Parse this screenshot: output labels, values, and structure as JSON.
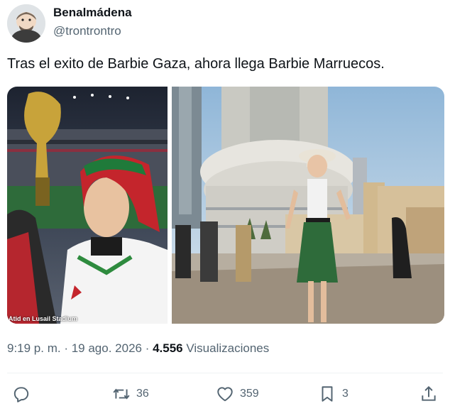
{
  "author": {
    "display_name": "Benalmádena",
    "handle": "@trontrontro",
    "avatar_icon": "cartoon-face-avatar"
  },
  "tweet": {
    "text": "Tras el exito de Barbie Gaza, ahora llega Barbie Marruecos."
  },
  "media": {
    "left_caption": "Atid en Lusail Stadium"
  },
  "meta": {
    "time": "9:19 p. m.",
    "separator1": " · ",
    "date": "19 ago. 2026",
    "separator2": " · ",
    "views_count": "4.556",
    "views_label": " Visualizaciones"
  },
  "actions": {
    "reply_icon": "reply-icon",
    "retweet_icon": "retweet-icon",
    "retweet_count": "36",
    "like_icon": "heart-icon",
    "like_count": "359",
    "bookmark_icon": "bookmark-icon",
    "bookmark_count": "3",
    "share_icon": "share-icon"
  },
  "colors": {
    "text_primary": "#0f1419",
    "text_secondary": "#536471",
    "divider": "#eff3f4"
  }
}
